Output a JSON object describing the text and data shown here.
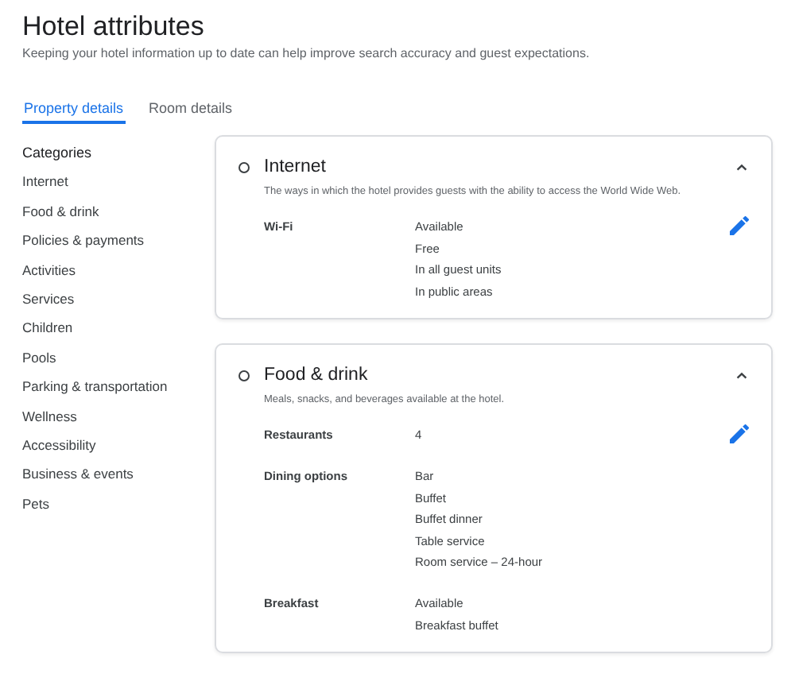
{
  "header": {
    "title": "Hotel attributes",
    "subtitle": "Keeping your hotel information up to date can help improve search accuracy and guest expectations."
  },
  "tabs": [
    {
      "label": "Property details",
      "selected": true
    },
    {
      "label": "Room details",
      "selected": false
    }
  ],
  "sidebar": {
    "heading": "Categories",
    "items": [
      "Internet",
      "Food & drink",
      "Policies & payments",
      "Activities",
      "Services",
      "Children",
      "Pools",
      "Parking & transportation",
      "Wellness",
      "Accessibility",
      "Business & events",
      "Pets"
    ]
  },
  "sections": [
    {
      "title": "Internet",
      "description": "The ways in which the hotel provides guests with the ability to access the World Wide Web.",
      "expanded": true,
      "attributes": [
        {
          "label": "Wi-Fi",
          "values": [
            "Available",
            "Free",
            "In all guest units",
            "In public areas"
          ]
        }
      ]
    },
    {
      "title": "Food & drink",
      "description": "Meals, snacks, and beverages available at the hotel.",
      "expanded": true,
      "attributes": [
        {
          "label": "Restaurants",
          "values": [
            "4"
          ]
        },
        {
          "label": "Dining options",
          "values": [
            "Bar",
            "Buffet",
            "Buffet dinner",
            "Table service",
            "Room service – 24-hour"
          ]
        },
        {
          "label": "Breakfast",
          "values": [
            "Available",
            "Breakfast buffet"
          ]
        }
      ]
    }
  ]
}
